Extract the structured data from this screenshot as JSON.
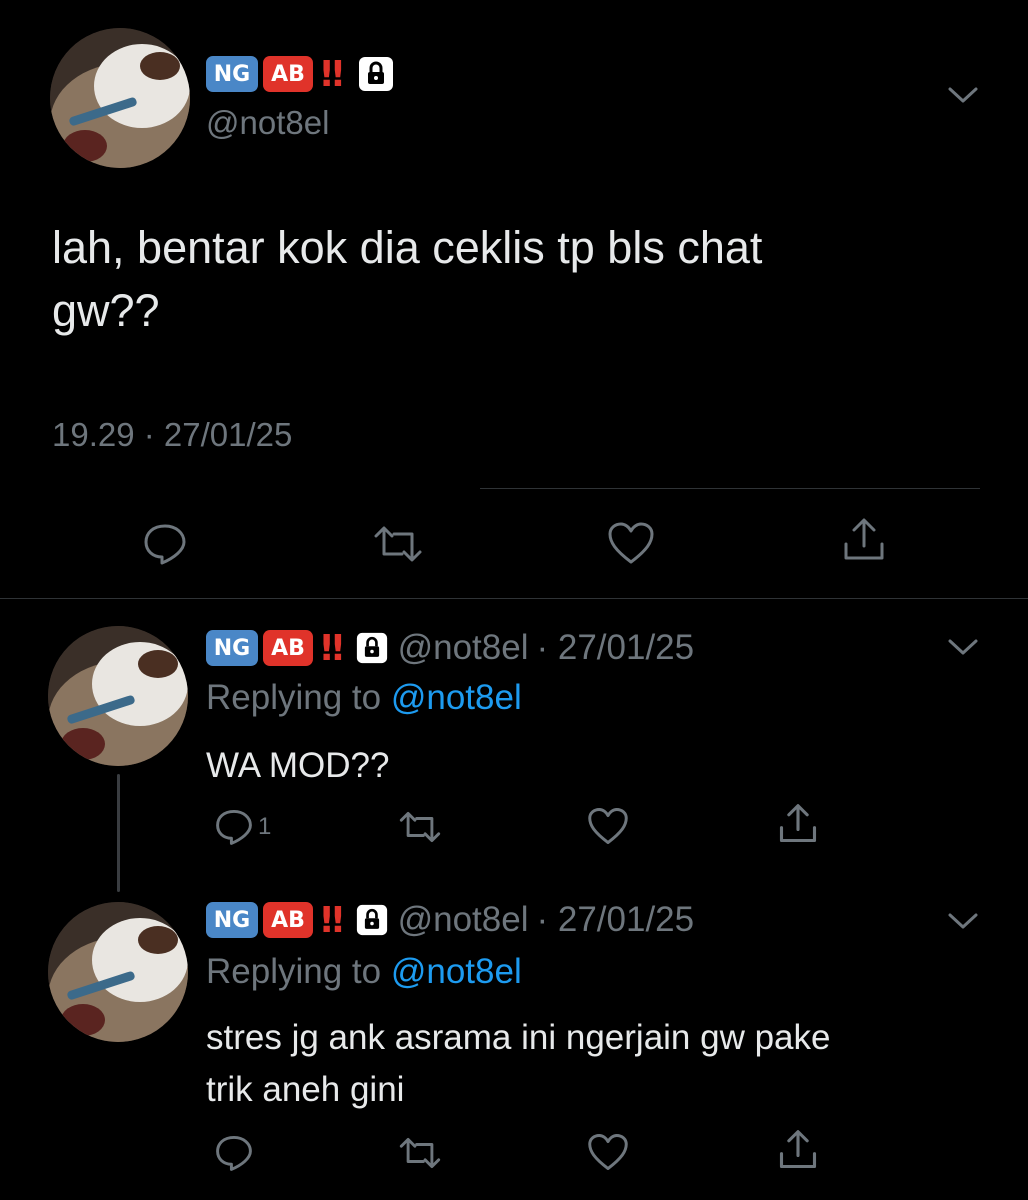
{
  "main_tweet": {
    "badges": {
      "ng": "NG",
      "ab": "AB",
      "bang": "‼"
    },
    "handle": "@not8el",
    "text_line1": "lah, bentar kok dia ceklis tp bls chat",
    "text_line2": "gw??",
    "timestamp": "19.29 · 27/01/25",
    "actions": {
      "reply_icon": "reply-icon",
      "retweet_icon": "retweet-icon",
      "like_icon": "like-icon",
      "share_icon": "share-icon"
    }
  },
  "replies": [
    {
      "badges": {
        "ng": "NG",
        "ab": "AB",
        "bang": "‼"
      },
      "handle": "@not8el",
      "date": "· 27/01/25",
      "replying_prefix": "Replying to",
      "replying_handle": "@not8el",
      "text_line1": "WA MOD??",
      "text_line2": "",
      "reply_count": "1"
    },
    {
      "badges": {
        "ng": "NG",
        "ab": "AB",
        "bang": "‼"
      },
      "handle": "@not8el",
      "date": "· 27/01/25",
      "replying_prefix": "Replying to",
      "replying_handle": "@not8el",
      "text_line1": "stres jg ank asrama ini ngerjain gw pake",
      "text_line2": "trik aneh gini",
      "reply_count": ""
    }
  ],
  "colors": {
    "background": "#000000",
    "text": "#e7e9ea",
    "muted": "#6e767d",
    "link": "#1d9bf0",
    "ng_badge": "#4a87c7",
    "ab_badge": "#e0332a"
  }
}
